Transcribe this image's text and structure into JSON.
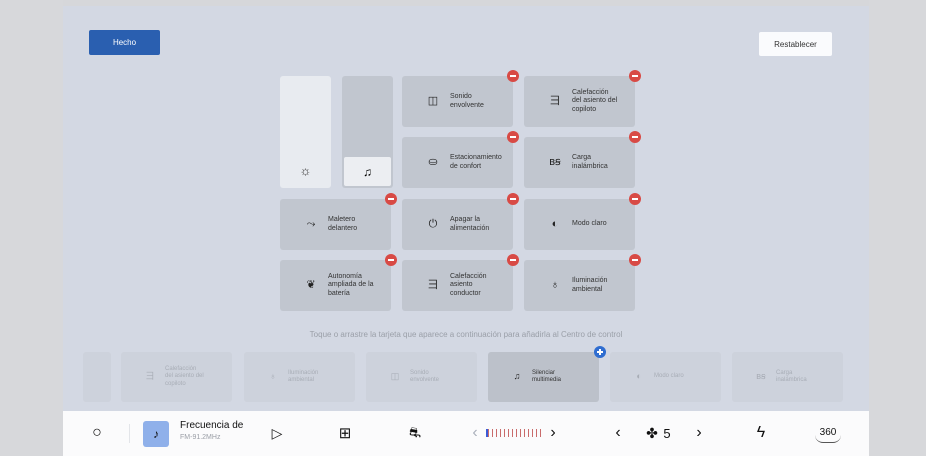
{
  "header": {
    "done_label": "Hecho",
    "reset_label": "Restablecer"
  },
  "active_tiles": [
    {
      "icon": "surround-sound-icon",
      "glyph": "◫",
      "label": "Sonido\nenvolvente"
    },
    {
      "icon": "passenger-seat-heat-icon",
      "glyph": "⺕",
      "label": "Calefacción\ndel asiento del\ncopiloto"
    },
    {
      "icon": "comfort-parking-icon",
      "glyph": "⛀",
      "label": "Estacionamiento\nde confort"
    },
    {
      "icon": "wireless-charging-icon",
      "glyph": "ʙꞩ",
      "label": "Carga\ninalámbrica"
    },
    {
      "icon": "front-trunk-icon",
      "glyph": "⤳",
      "label": "Maletero\ndelantero"
    },
    {
      "icon": "power-icon",
      "glyph": "⏻",
      "label": "Apagar la\nalimentación"
    },
    {
      "icon": "light-mode-icon",
      "glyph": "◐",
      "label": "Modo claro"
    },
    {
      "icon": "extended-range-icon",
      "glyph": "❦",
      "label": "Autonomía\nampliada de la\nbatería"
    },
    {
      "icon": "driver-seat-heat-icon",
      "glyph": "⺕",
      "label": "Calefacción\nasiento\nconductor"
    },
    {
      "icon": "ambient-light-icon",
      "glyph": "♁",
      "label": "Iluminación\nambiental"
    }
  ],
  "sliders": {
    "brightness_icon": "☼",
    "volume_icon": "♫"
  },
  "hint": "Toque o arrastre la tarjeta que aparece a continuación para añadirla al Centro de control",
  "tray_tiles": [
    {
      "icon": "passenger-seat-heat-icon",
      "glyph": "⺕",
      "label": "Calefacción\ndel asiento del\ncopiloto"
    },
    {
      "icon": "ambient-light-icon",
      "glyph": "♁",
      "label": "Iluminación\nambiental"
    },
    {
      "icon": "surround-sound-icon",
      "glyph": "◫",
      "label": "Sonido\nenvolvente"
    },
    {
      "icon": "mute-media-icon",
      "glyph": "♫",
      "label": "Silenciar\nmultimedia"
    },
    {
      "icon": "light-mode-icon",
      "glyph": "◐",
      "label": "Modo claro"
    },
    {
      "icon": "wireless-charging-icon",
      "glyph": "ʙꞩ",
      "label": "Carga\ninalámbrica"
    }
  ],
  "taskbar": {
    "home_glyph": "○",
    "radio_title": "Frecuencia de",
    "radio_sub": "FM-91.2MHz",
    "play_glyph": "▷",
    "apps_glyph": "⊞",
    "car_glyph": "⛐",
    "temp_left": "‹",
    "temp_right": "›",
    "fan_left": "‹",
    "fan_glyph": "✤",
    "fan_speed": "5",
    "fan_right": "›",
    "bolt_glyph": "ϟ",
    "view360": "360"
  }
}
